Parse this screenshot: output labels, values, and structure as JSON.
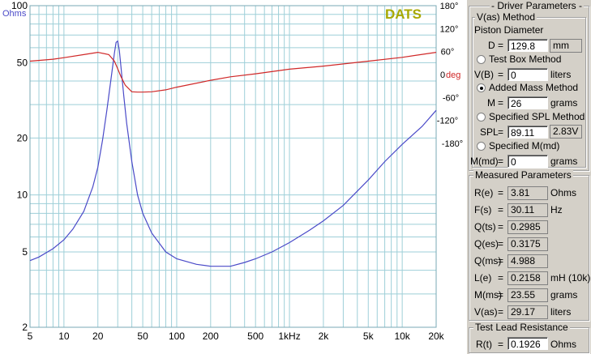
{
  "plot": {
    "brand": "DATS",
    "y_unit": "Ohms",
    "phase_unit": "deg",
    "y_ticks": [
      "100",
      "50",
      "20",
      "10",
      "5",
      "2"
    ],
    "phase_ticks": [
      "180°",
      "120°",
      "60°",
      "0",
      "-60°",
      "-120°",
      "-180°"
    ],
    "x_ticks": [
      "5",
      "10",
      "20",
      "50",
      "100",
      "200",
      "500",
      "1kHz",
      "2k",
      "5k",
      "10k",
      "20k"
    ],
    "colors": {
      "impedance": "#4a4ac8",
      "phase": "#d02828",
      "grid": "#9ecfd8",
      "brand": "#a8a800"
    }
  },
  "chart_data": {
    "type": "line",
    "xlabel": "",
    "ylabel": "Ohms",
    "x_scale": "log",
    "y_scale": "log",
    "xlim": [
      5,
      20000
    ],
    "ylim": [
      2,
      100
    ],
    "y2lim": [
      -180,
      180
    ],
    "series": [
      {
        "unit": "Ohms",
        "x": [
          5,
          6,
          8,
          10,
          12,
          15,
          18,
          20,
          22,
          24,
          26,
          28,
          29,
          30,
          31,
          32,
          34,
          36,
          40,
          45,
          50,
          60,
          80,
          100,
          150,
          200,
          300,
          400,
          500,
          700,
          1000,
          1500,
          2000,
          3000,
          5000,
          7000,
          10000,
          15000,
          20000
        ],
        "y": [
          4.5,
          4.7,
          5.2,
          5.8,
          6.6,
          8.2,
          11.0,
          14.0,
          19.5,
          28.0,
          40.0,
          56.0,
          64.0,
          65.0,
          58.0,
          48.0,
          33.0,
          24.0,
          15.0,
          10.0,
          8.0,
          6.3,
          5.0,
          4.6,
          4.3,
          4.2,
          4.2,
          4.4,
          4.6,
          5.0,
          5.6,
          6.5,
          7.3,
          8.8,
          12.0,
          15.0,
          18.5,
          23.0,
          28.0
        ]
      },
      {
        "unit": "deg",
        "x": [
          5,
          8,
          10,
          15,
          20,
          25,
          28,
          30,
          32,
          35,
          40,
          45,
          50,
          60,
          80,
          100,
          200,
          300,
          500,
          1000,
          2000,
          5000,
          10000,
          20000
        ],
        "y": [
          35,
          40,
          44,
          52,
          58,
          52,
          35,
          15,
          -5,
          -28,
          -45,
          -46,
          -46,
          -45,
          -40,
          -33,
          -15,
          -6,
          2,
          14,
          22,
          35,
          45,
          58
        ]
      }
    ]
  },
  "panel": {
    "driver_title": "- Driver Parameters -",
    "vas_title": "V(as) Method",
    "piston_label": "Piston Diameter",
    "d_label": "D",
    "d_value": "129.8",
    "d_unit": "mm",
    "testbox_label": "Test Box Method",
    "vb_label": "V(B)",
    "vb_value": "0",
    "vb_unit": "liters",
    "addedmass_label": "Added Mass Method",
    "m_label": "M",
    "m_value": "26",
    "m_unit": "grams",
    "spl_method_label": "Specified SPL Method",
    "spl_label": "SPL",
    "spl_value": "89.11",
    "spl_volt": "2.83V",
    "mmd_method_label": "Specified M(md)",
    "mmd_label": "M(md)",
    "mmd_value": "0",
    "mmd_unit": "grams",
    "measured_title": "Measured Parameters",
    "measured": [
      {
        "label": "R(e)",
        "value": "3.81",
        "unit": "Ohms"
      },
      {
        "label": "F(s)",
        "value": "30.11",
        "unit": "Hz"
      },
      {
        "label": "Q(ts)",
        "value": "0.2985",
        "unit": ""
      },
      {
        "label": "Q(es)",
        "value": "0.3175",
        "unit": ""
      },
      {
        "label": "Q(ms)",
        "value": "4.988",
        "unit": ""
      },
      {
        "label": "L(e)",
        "value": "0.2158",
        "unit": "mH (10k)"
      },
      {
        "label": "M(ms)",
        "value": "23.55",
        "unit": "grams"
      },
      {
        "label": "V(as)",
        "value": "29.17",
        "unit": "liters"
      }
    ],
    "lead_title": "Test Lead Resistance",
    "rt_label": "R(t)",
    "rt_value": "0.1926",
    "rt_unit": "Ohms"
  }
}
